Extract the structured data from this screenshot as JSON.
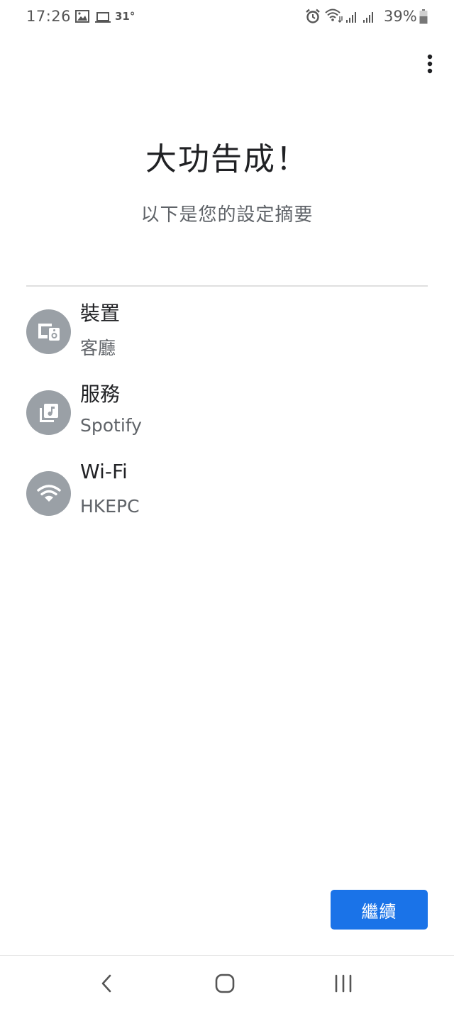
{
  "status_bar": {
    "time": "17:26",
    "temperature": "31°",
    "battery_percent": "39%",
    "icons": [
      "gallery-icon",
      "laptop-icon",
      "alarm-icon",
      "wifi-icon",
      "signal-icon",
      "signal-icon",
      "battery-icon"
    ]
  },
  "app_bar": {
    "menu_icon": "more-vert-icon"
  },
  "header": {
    "title": "大功告成！",
    "subtitle": "以下是您的設定摘要"
  },
  "summary": {
    "items": [
      {
        "label": "裝置",
        "value": "客廳",
        "icon": "speaker-device-icon"
      },
      {
        "label": "服務",
        "value": "Spotify",
        "icon": "music-library-icon"
      },
      {
        "label": "Wi-Fi",
        "value": "HKEPC",
        "icon": "wifi-icon"
      }
    ]
  },
  "footer": {
    "continue_label": "繼續"
  },
  "colors": {
    "accent": "#1a73e8",
    "icon_circle": "#9aa0a6",
    "primary_text": "#202124",
    "secondary_text": "#5f6368"
  },
  "nav_bar": {
    "icons": [
      "back-icon",
      "home-icon",
      "recents-icon"
    ]
  }
}
